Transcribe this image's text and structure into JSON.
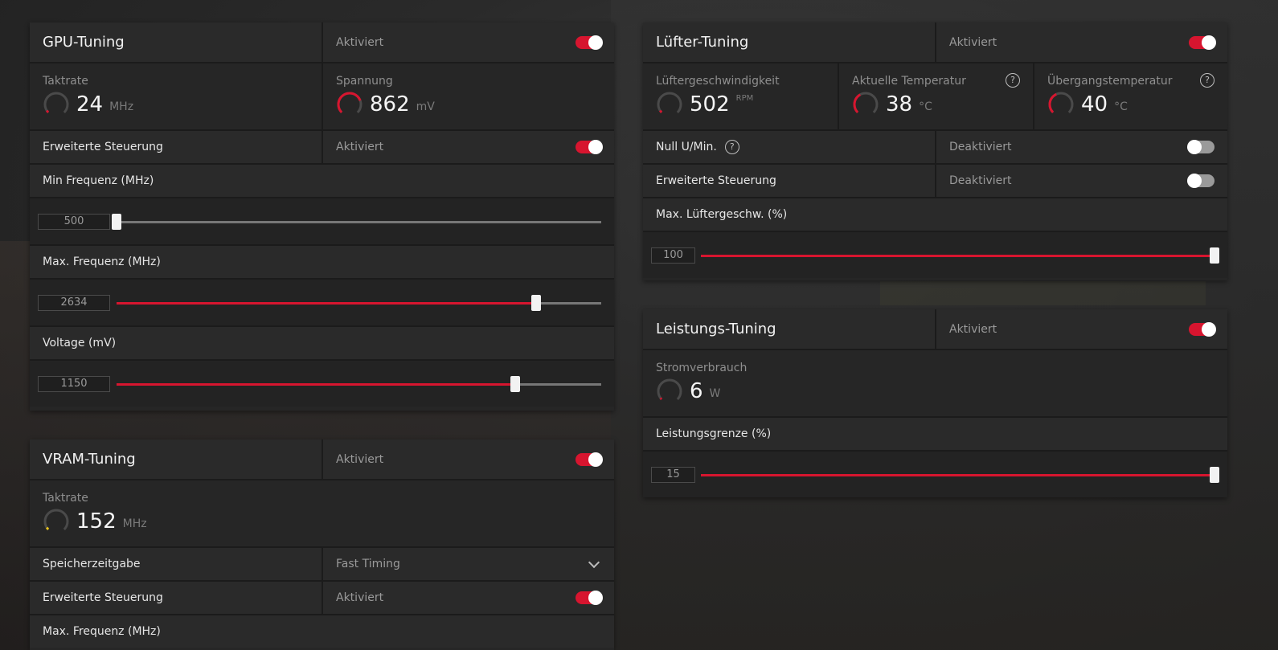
{
  "gpu": {
    "title": "GPU-Tuning",
    "status": "Aktiviert",
    "clock": {
      "label": "Taktrate",
      "value": "24",
      "unit": "MHz"
    },
    "voltage_read": {
      "label": "Spannung",
      "value": "862",
      "unit": "mV"
    },
    "advanced": {
      "label": "Erweiterte Steuerung",
      "status": "Aktiviert"
    },
    "min_freq": {
      "label": "Min Frequenz (MHz)",
      "value": "500",
      "fraction": 0.0
    },
    "max_freq": {
      "label": "Max. Frequenz (MHz)",
      "value": "2634",
      "fraction": 0.865
    },
    "voltage": {
      "label": "Voltage (mV)",
      "value": "1150",
      "fraction": 0.822
    }
  },
  "vram": {
    "title": "VRAM-Tuning",
    "status": "Aktiviert",
    "clock": {
      "label": "Taktrate",
      "value": "152",
      "unit": "MHz"
    },
    "timing": {
      "label": "Speicherzeitgabe",
      "value": "Fast Timing"
    },
    "advanced": {
      "label": "Erweiterte Steuerung",
      "status": "Aktiviert"
    },
    "max_freq": {
      "label": "Max. Frequenz (MHz)"
    }
  },
  "fan": {
    "title": "Lüfter-Tuning",
    "status": "Aktiviert",
    "speed": {
      "label": "Lüftergeschwindigkeit",
      "value": "502",
      "unit": "RPM"
    },
    "current_temp": {
      "label": "Aktuelle Temperatur",
      "value": "38",
      "unit": "°C"
    },
    "junction_temp": {
      "label": "Übergangstemperatur",
      "value": "40",
      "unit": "°C"
    },
    "zero_rpm": {
      "label": "Null U/Min.",
      "status": "Deaktiviert"
    },
    "advanced": {
      "label": "Erweiterte Steuerung",
      "status": "Deaktiviert"
    },
    "max_speed": {
      "label": "Max. Lüftergeschw. (%)",
      "value": "100",
      "fraction": 1.0
    }
  },
  "power": {
    "title": "Leistungs-Tuning",
    "status": "Aktiviert",
    "consumption": {
      "label": "Stromverbrauch",
      "value": "6",
      "unit": "W"
    },
    "limit": {
      "label": "Leistungsgrenze (%)",
      "value": "15",
      "fraction": 1.0
    }
  },
  "help_symbol": "?",
  "colors": {
    "accent": "#d7152f",
    "gauge_track": "#4a4a4a",
    "gauge_yellow": "#e8c21a"
  }
}
